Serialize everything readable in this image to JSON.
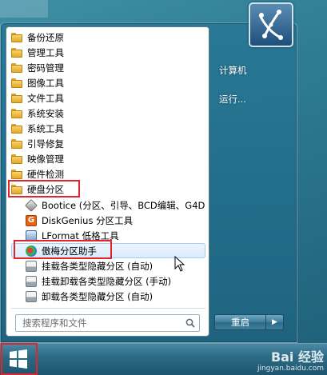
{
  "start_menu": {
    "folders": [
      {
        "label": "备份还原"
      },
      {
        "label": "管理工具"
      },
      {
        "label": "密码管理"
      },
      {
        "label": "图像工具"
      },
      {
        "label": "文件工具"
      },
      {
        "label": "系统安装"
      },
      {
        "label": "系统工具"
      },
      {
        "label": "引导修复"
      },
      {
        "label": "映像管理"
      },
      {
        "label": "硬件检测"
      },
      {
        "label": "硬盘分区"
      }
    ],
    "programs": [
      {
        "label": "Bootice (分区、引导、BCD编辑、G4D",
        "icon": "bootice-icon"
      },
      {
        "label": "DiskGenius 分区工具",
        "icon": "diskgenius-icon"
      },
      {
        "label": "LFormat 低格工具",
        "icon": "lformat-icon"
      },
      {
        "label": "傲梅分区助手",
        "icon": "aomei-icon"
      },
      {
        "label": "挂载各类型隐藏分区 (自动)",
        "icon": "drive-icon"
      },
      {
        "label": "挂载卸载各类型隐藏分区 (手动)",
        "icon": "drive-icon"
      },
      {
        "label": "卸载各类型隐藏分区 (自动)",
        "icon": "drive-icon"
      }
    ],
    "search_placeholder": "搜索程序和文件",
    "right_items": [
      {
        "label": "计算机"
      },
      {
        "label": "运行..."
      }
    ],
    "shutdown_label": "重启",
    "shutdown_arrow": "▶"
  },
  "watermark": {
    "brand": "Bai 经验",
    "url": "jingyan.baidu.com"
  },
  "colors": {
    "highlight_red": "#e0262a",
    "glass": "#2a7a96"
  }
}
